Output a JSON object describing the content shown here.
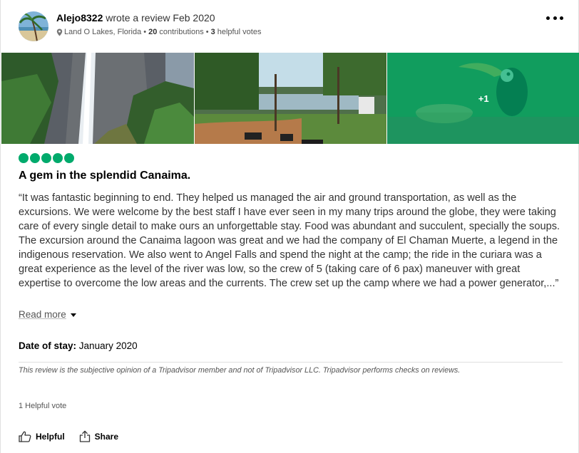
{
  "review": {
    "user": "Alejo8322",
    "action_text": "wrote a review Feb 2020",
    "location": "Land O Lakes, Florida",
    "contributions_count": "20",
    "contributions_label": "contributions",
    "helpful_count": "3",
    "helpful_label": "helpful votes",
    "separator": "•",
    "more_photos_label": "+1",
    "rating": 5,
    "title": "A gem in the splendid Canaima.",
    "body": "“It was fantastic beginning to end. They helped us managed the air and ground transportation, as well as the excursions. We were welcome by the best staff I have ever seen in my many trips around the globe, they were taking care of every single detail to make ours an unforgettable stay. Food was abundant and succulent, specially the soups. The excursion around the Canaima lagoon was great and we had the company of El Chaman Muerte, a legend in the indigenous reservation. We also went to Angel Falls and spend the night at the camp; the ride in the curiara was a great experience as the level of the river was low, so the crew of 5 (taking care of 6 pax) maneuver with great expertise to overcome the low areas and the currents. The crew set up the camp where we had a power generator,...”",
    "read_more_label": "Read more",
    "date_of_stay_label": "Date of stay:",
    "date_of_stay": "January 2020",
    "disclaimer": "This review is the subjective opinion of a Tripadvisor member and not of Tripadvisor LLC. Tripadvisor performs checks on reviews.",
    "helpful_votes_text": "1 Helpful vote",
    "helpful_button": "Helpful",
    "share_button": "Share"
  },
  "colors": {
    "bubble": "#00aa6c",
    "overlay": "#00aa6c"
  }
}
